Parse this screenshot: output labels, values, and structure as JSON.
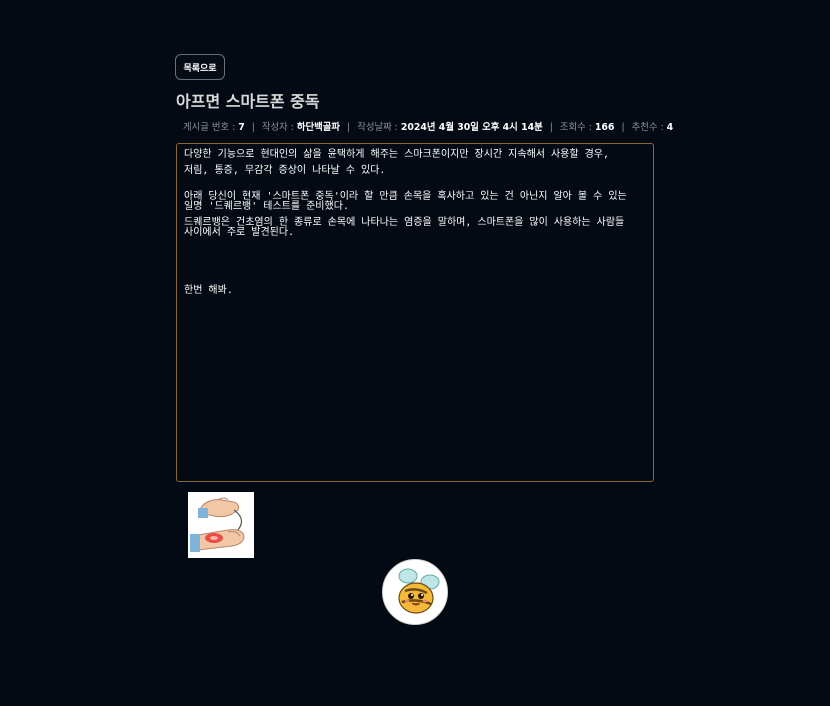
{
  "nav": {
    "back_label": "목록으로"
  },
  "post": {
    "title": "아프면 스마트폰 중독",
    "meta": {
      "number_label": "게시글 번호 :",
      "number_value": "7",
      "author_label": "작성자 :",
      "author_value": "하단백골파",
      "date_label": "작성날짜 :",
      "date_value": "2024년 4월 30일 오후 4시 14분",
      "views_label": "조회수 :",
      "views_value": "166",
      "likes_label": "추천수 :",
      "likes_value": "4",
      "separator": "|"
    },
    "body": {
      "p1": "다양한 기능으로 현대인의 삶을 윤택하게 해주는 스마크폰이지만 장시간 지속해서 사용할 경우,",
      "p2": "저림, 통증, 무감각 증상이 나타날 수 있다.",
      "p3": "아래 당신이 현재 '스마트폰 중독'이라 할 만큼 손목을 혹사하고 있는 건 아닌지 알아 볼 수 있는 일명 '드퀘르뱅' 테스트를 준비했다.",
      "p4": "드퀘르뱅은 건초염의 한 종류로 손목에 나타나는 염증을 말하며, 스마트폰을 많이 사용하는 사람들 사이에서 주로 발견된다.",
      "p5": "한번 해봐."
    }
  },
  "colors": {
    "background": "#040a13",
    "content_border": "#8a6a2c",
    "meta_label": "#8b9099",
    "text": "#ffffff"
  },
  "icons": {
    "thumbnail": "wrist-stretch-illustration",
    "avatar": "bee-character-avatar"
  }
}
